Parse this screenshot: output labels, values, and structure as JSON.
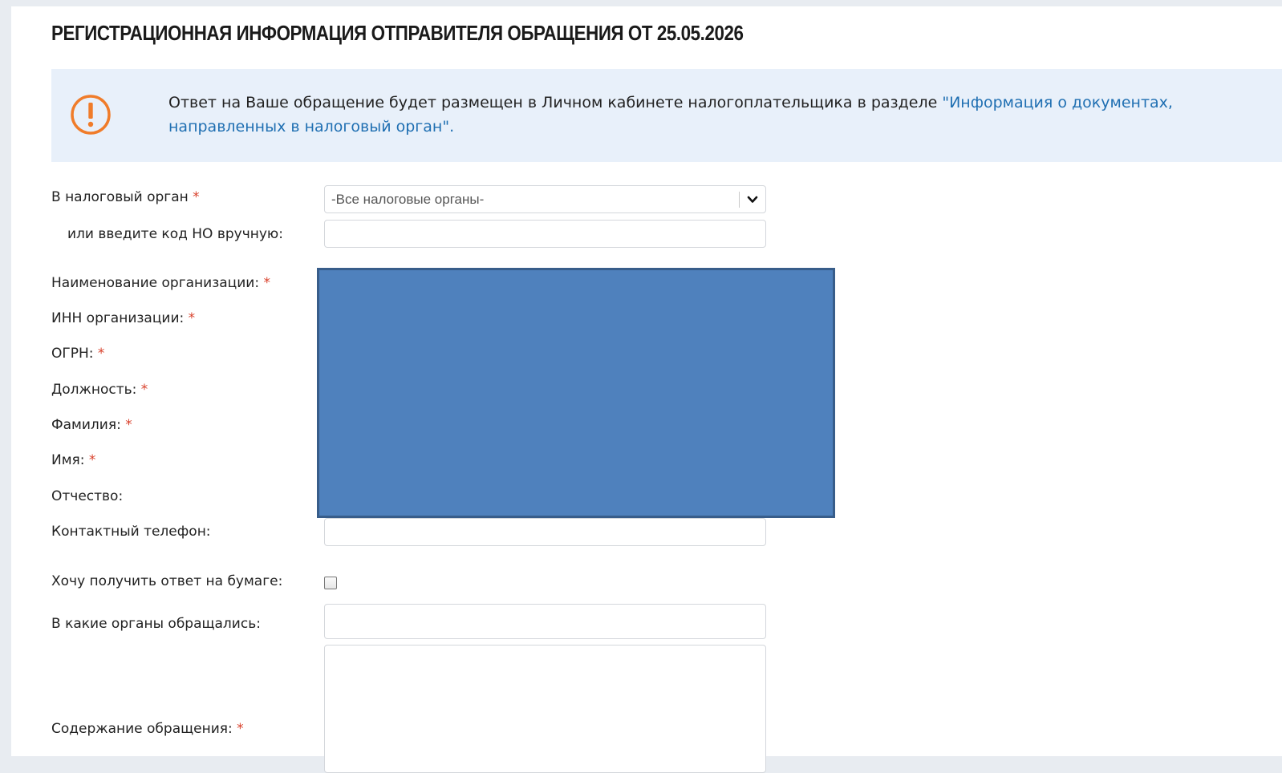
{
  "header": {
    "title": "РЕГИСТРАЦИОННАЯ ИНФОРМАЦИЯ ОТПРАВИТЕЛЯ ОБРАЩЕНИЯ ОТ 25.05.2026"
  },
  "notice": {
    "icon": "exclamation-circle-icon",
    "icon_color": "#f07c2a",
    "text": "Ответ на Ваше обращение будет размещен в Личном кабинете налогоплательщика в разделе ",
    "link": "\"Информация о документах, направленных в налоговый орган\"."
  },
  "form": {
    "tax_authority": {
      "label": "В налоговый орган",
      "required_mark": "*",
      "selected": "-Все налоговые органы-"
    },
    "manual_code": {
      "label": "или введите код НО вручную:",
      "value": ""
    },
    "org_name": {
      "label": "Наименование организации:",
      "required_mark": "*"
    },
    "inn": {
      "label": "ИНН организации:",
      "required_mark": "*"
    },
    "ogrn": {
      "label": "ОГРН:",
      "required_mark": "*"
    },
    "position": {
      "label": "Должность:",
      "required_mark": "*"
    },
    "surname": {
      "label": "Фамилия:",
      "required_mark": "*"
    },
    "first_name": {
      "label": "Имя:",
      "required_mark": "*"
    },
    "patronymic": {
      "label": "Отчество:"
    },
    "phone": {
      "label": "Контактный телефон:",
      "value": ""
    },
    "paper_reply": {
      "label": "Хочу получить ответ на бумаге:",
      "checked": false
    },
    "previous_authorities": {
      "label": "В какие органы обращались:",
      "value": ""
    },
    "content": {
      "label": "Содержание обращения:",
      "required_mark": "*",
      "value": ""
    }
  },
  "colors": {
    "accent_link": "#1f6fb2",
    "required": "#d9412c",
    "notice_bg": "#e8f0fa",
    "redaction": "#4f81bd"
  }
}
